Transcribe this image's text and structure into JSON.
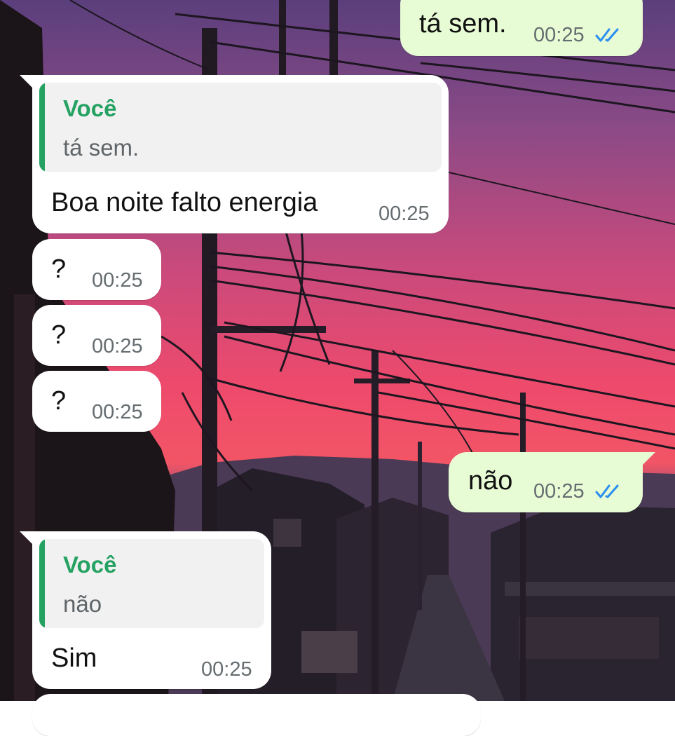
{
  "colors": {
    "incoming_bubble": "#ffffff",
    "outgoing_bubble": "#e7fbd4",
    "quote_accent": "#25a262",
    "read_ticks": "#2a8ef0",
    "timestamp": "#666d70"
  },
  "icons": {
    "read_receipt": "double-check-icon"
  },
  "messages": [
    {
      "direction": "outgoing",
      "text": "tá sem.",
      "time": "00:25",
      "status": "read"
    },
    {
      "direction": "incoming",
      "quote_author": "Você",
      "quote_text": "tá sem.",
      "text": "Boa noite falto energia",
      "time": "00:25"
    },
    {
      "direction": "incoming",
      "text": "?",
      "time": "00:25"
    },
    {
      "direction": "incoming",
      "text": "?",
      "time": "00:25"
    },
    {
      "direction": "incoming",
      "text": "?",
      "time": "00:25"
    },
    {
      "direction": "outgoing",
      "text": "não",
      "time": "00:25",
      "status": "read"
    },
    {
      "direction": "incoming",
      "quote_author": "Você",
      "quote_text": "não",
      "text": "Sim",
      "time": "00:25"
    }
  ]
}
